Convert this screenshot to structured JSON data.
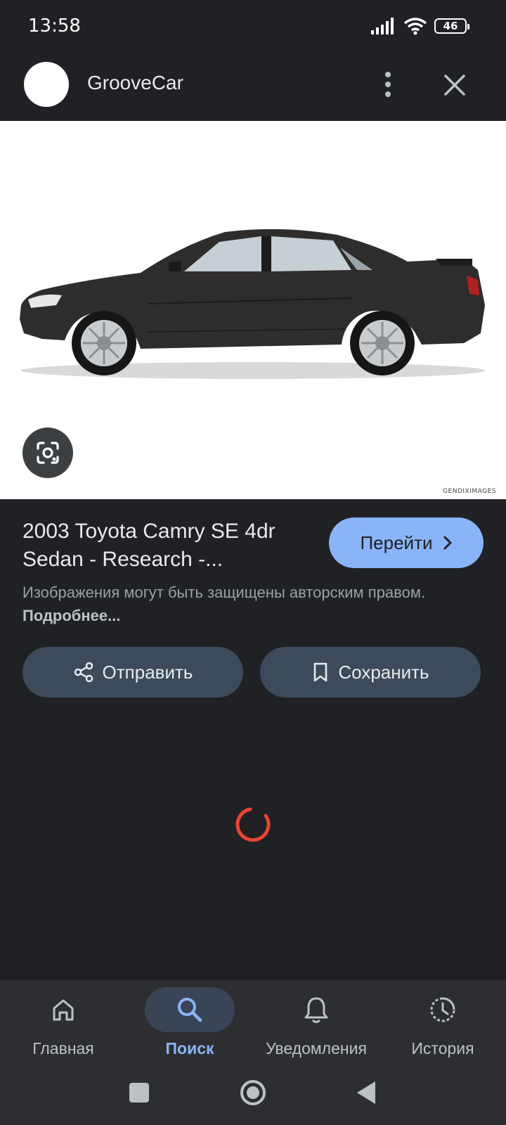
{
  "status_bar": {
    "time": "13:58",
    "battery": "46"
  },
  "header": {
    "site_name": "GrooveCar"
  },
  "image": {
    "watermark": "GENDIXIMAGES"
  },
  "result": {
    "title": "2003 Toyota Camry SE 4dr Sedan - Research -...",
    "visit_label": "Перейти",
    "copyright_text": "Изображения могут быть защищены авторским правом.",
    "copyright_link": "Подробнее..."
  },
  "actions": {
    "share_label": "Отправить",
    "save_label": "Сохранить"
  },
  "bottom_nav": [
    {
      "label": "Главная",
      "icon": "home-icon",
      "active": false
    },
    {
      "label": "Поиск",
      "icon": "search-icon",
      "active": true
    },
    {
      "label": "Уведомления",
      "icon": "bell-icon",
      "active": false
    },
    {
      "label": "История",
      "icon": "history-icon",
      "active": false
    }
  ],
  "colors": {
    "accent": "#8ab4f8",
    "background": "#202124",
    "spinner": "#ea4335"
  }
}
